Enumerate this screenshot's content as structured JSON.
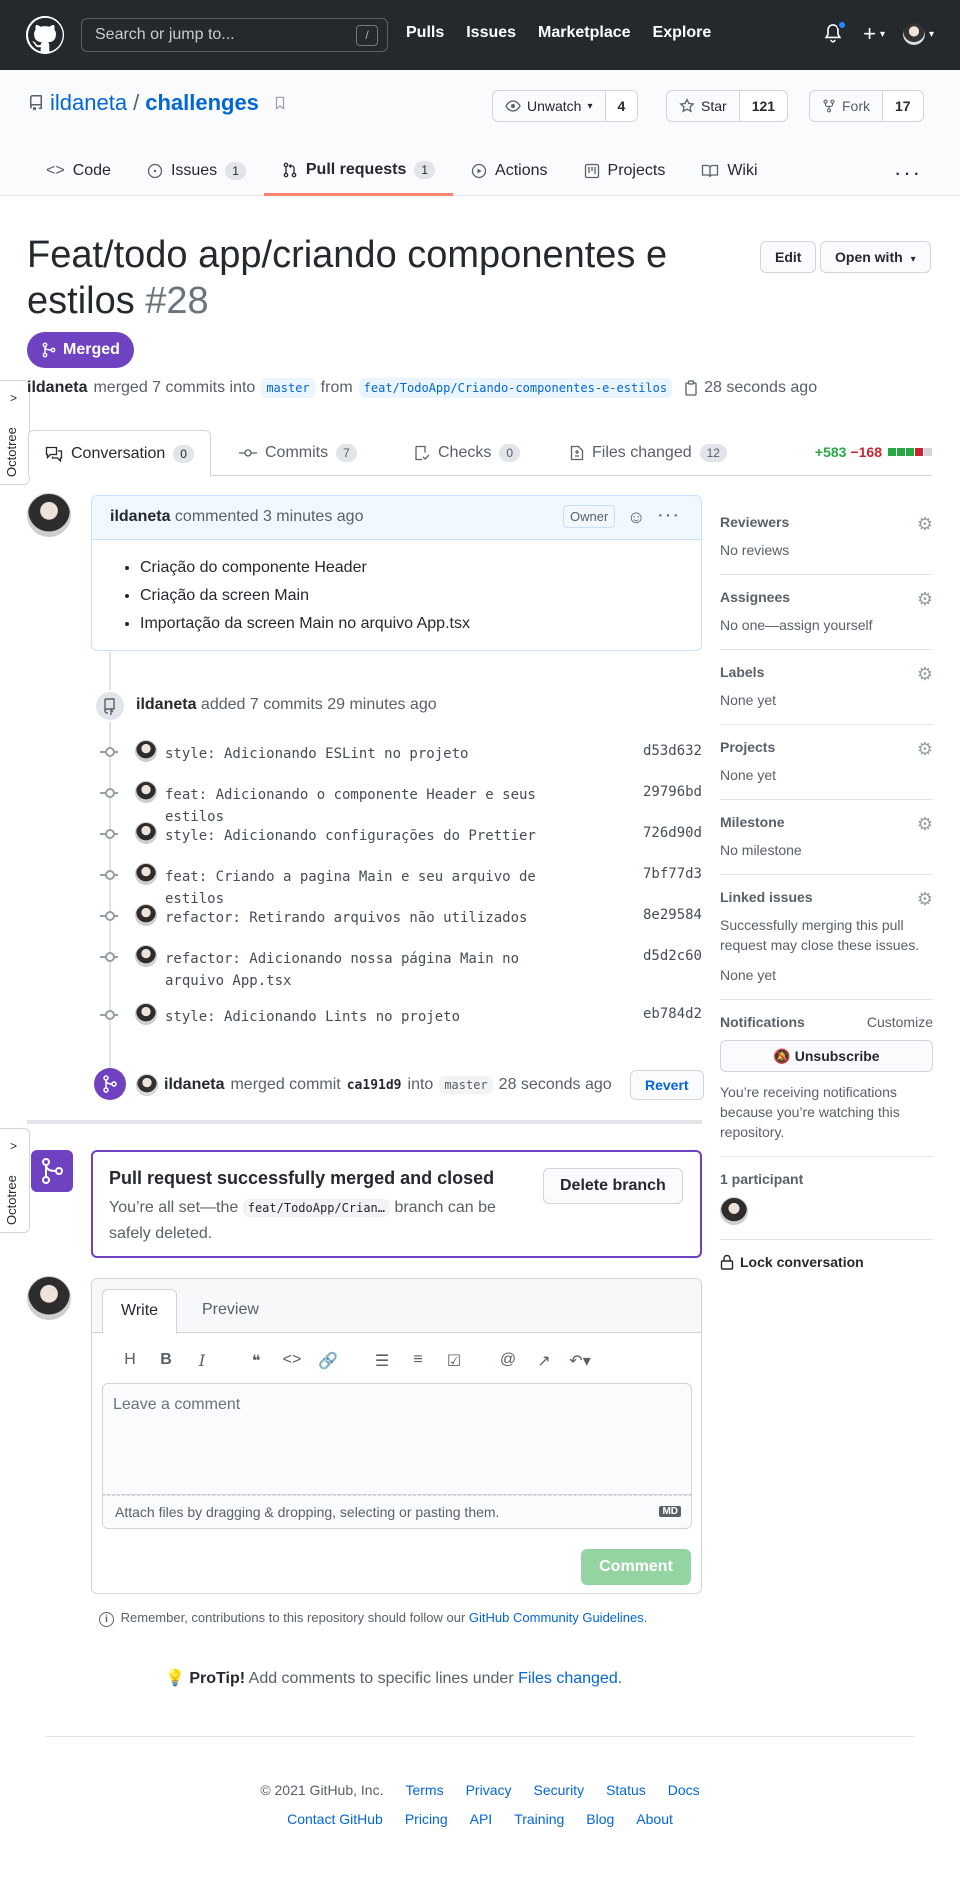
{
  "header": {
    "search_placeholder": "Search or jump to...",
    "slash_key": "/",
    "nav": [
      "Pulls",
      "Issues",
      "Marketplace",
      "Explore"
    ],
    "plus": "+",
    "caret": "▾"
  },
  "repo": {
    "owner": "ildaneta",
    "separator": "/",
    "name": "challenges",
    "watch_label": "Unwatch",
    "watch_count": "4",
    "star_label": "Star",
    "star_count": "121",
    "fork_label": "Fork",
    "fork_count": "17",
    "tabs": [
      {
        "label": "Code",
        "count": ""
      },
      {
        "label": "Issues",
        "count": "1"
      },
      {
        "label": "Pull requests",
        "count": "1"
      },
      {
        "label": "Actions",
        "count": ""
      },
      {
        "label": "Projects",
        "count": ""
      },
      {
        "label": "Wiki",
        "count": ""
      }
    ],
    "more": "···"
  },
  "pr": {
    "title": "Feat/todo app/criando componentes e estilos",
    "number": "#28",
    "edit_label": "Edit",
    "open_with_label": "Open with",
    "state": "Merged",
    "meta_author": "ildaneta",
    "meta_text": "merged 7 commits into",
    "base_branch": "master",
    "from_text": "from",
    "head_branch": "feat/TodoApp/Criando-componentes-e-estilos",
    "time": "28 seconds ago",
    "octotree": "Octotree",
    "tabs": [
      {
        "label": "Conversation",
        "count": "0"
      },
      {
        "label": "Commits",
        "count": "7"
      },
      {
        "label": "Checks",
        "count": "0"
      },
      {
        "label": "Files changed",
        "count": "12"
      }
    ],
    "additions": "+583",
    "deletions": "−168"
  },
  "comment": {
    "author": "ildaneta",
    "action": "commented 3 minutes ago",
    "role": "Owner",
    "more": "···",
    "items": [
      "Criação do componente Header",
      "Criação da screen Main",
      "Importação da screen Main no arquivo App.tsx"
    ]
  },
  "commits_event": {
    "author": "ildaneta",
    "text": "added 7 commits 29 minutes ago",
    "commits": [
      {
        "msg": "style: Adicionando ESLint no projeto",
        "sha": "d53d632"
      },
      {
        "msg": "feat: Adicionando o componente Header e seus estilos",
        "sha": "29796bd"
      },
      {
        "msg": "style: Adicionando configurações do Prettier",
        "sha": "726d90d"
      },
      {
        "msg": "feat: Criando a pagina Main e seu arquivo de estilos",
        "sha": "7bf77d3"
      },
      {
        "msg": "refactor: Retirando arquivos não utilizados",
        "sha": "8e29584"
      },
      {
        "msg": "refactor: Adicionando nossa página Main no arquivo App.tsx",
        "sha": "d5d2c60"
      },
      {
        "msg": "style: Adicionando Lints no projeto",
        "sha": "eb784d2"
      }
    ]
  },
  "merge_event": {
    "author": "ildaneta",
    "text": "merged commit",
    "sha": "ca191d9",
    "into": "into",
    "branch": "master",
    "time": "28 seconds ago",
    "revert": "Revert"
  },
  "merged_box": {
    "title": "Pull request successfully merged and closed",
    "text_before": "You’re all set—the",
    "branch": "feat/TodoApp/Crian…",
    "text_after": "branch can be safely deleted.",
    "delete_label": "Delete branch"
  },
  "composer": {
    "write": "Write",
    "preview": "Preview",
    "placeholder": "Leave a comment",
    "attach": "Attach files by dragging & dropping, selecting or pasting them.",
    "md": "MD",
    "comment_label": "Comment"
  },
  "remember": {
    "text": "Remember, contributions to this repository should follow our",
    "link": "GitHub Community Guidelines",
    "end": "."
  },
  "protip": {
    "bold": "ProTip!",
    "text": "Add comments to specific lines under",
    "link": "Files changed",
    "end": "."
  },
  "sidebar": {
    "reviewers": {
      "h": "Reviewers",
      "v": "No reviews"
    },
    "assignees": {
      "h": "Assignees",
      "v": "No one—assign yourself"
    },
    "labels": {
      "h": "Labels",
      "v": "None yet"
    },
    "projects": {
      "h": "Projects",
      "v": "None yet"
    },
    "milestone": {
      "h": "Milestone",
      "v": "No milestone"
    },
    "linked": {
      "h": "Linked issues",
      "desc": "Successfully merging this pull request may close these issues.",
      "v": "None yet"
    },
    "notifications": {
      "h": "Notifications",
      "customize": "Customize",
      "button": "Unsubscribe",
      "desc": "You’re receiving notifications because you’re watching this repository."
    },
    "participants": {
      "h": "1 participant"
    },
    "lock": "Lock conversation"
  },
  "footer": {
    "copyright": "© 2021 GitHub, Inc.",
    "row1": [
      "Terms",
      "Privacy",
      "Security",
      "Status",
      "Docs"
    ],
    "row2": [
      "Contact GitHub",
      "Pricing",
      "API",
      "Training",
      "Blog",
      "About"
    ]
  },
  "colors": {
    "header_bg": "#24292e",
    "merged": "#6f42c1",
    "link": "#0366d6",
    "add": "#28a745",
    "del": "#cb2431"
  }
}
